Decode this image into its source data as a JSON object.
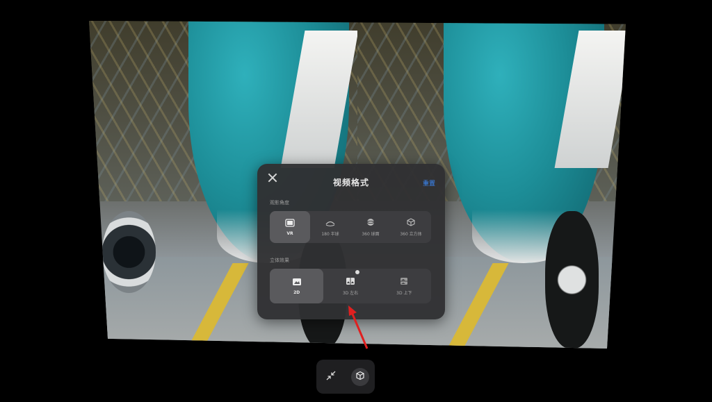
{
  "dialog": {
    "title": "视频格式",
    "reset_label": "重置",
    "view_angle": {
      "heading": "观影角度",
      "options": [
        {
          "label": "VR",
          "icon": "film-icon",
          "selected": true
        },
        {
          "label": "180 半球",
          "icon": "dome-180-icon",
          "selected": false
        },
        {
          "label": "360 球面",
          "icon": "sphere-360-icon",
          "selected": false
        },
        {
          "label": "360 立方体",
          "icon": "cube-360-icon",
          "selected": false
        }
      ]
    },
    "stereo": {
      "heading": "立体效果",
      "options": [
        {
          "label": "2D",
          "icon": "image-2d-icon",
          "selected": true
        },
        {
          "label": "3D 左右",
          "icon": "image-side-by-side-icon",
          "selected": false
        },
        {
          "label": "3D 上下",
          "icon": "image-top-bottom-icon",
          "selected": false
        }
      ]
    }
  },
  "bottom_bar": {
    "buttons": [
      {
        "icon": "collapse-arrows-icon"
      },
      {
        "icon": "cube-icon",
        "active": true
      }
    ]
  },
  "colors": {
    "accent": "#3a8cff",
    "annotation_arrow": "#e02020",
    "dialog_bg": "#303032"
  }
}
